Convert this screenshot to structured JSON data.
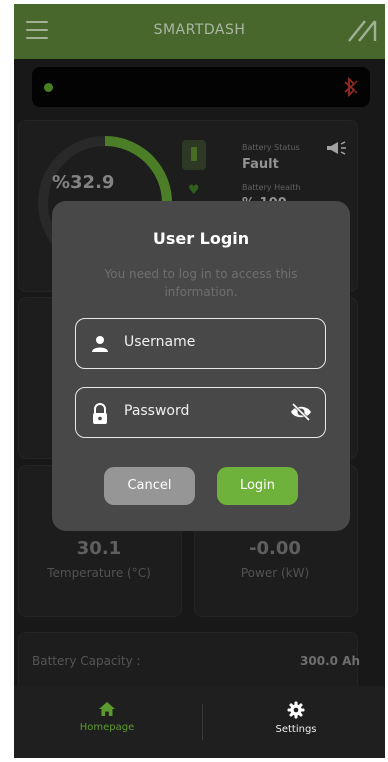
{
  "app": {
    "title": "SMARTDASH"
  },
  "dashboard": {
    "soc_value": "%32.9",
    "soc_fraction": 0.329,
    "battery_status_label": "Battery Status",
    "battery_status_value": "Fault",
    "battery_health_label": "Battery Health",
    "battery_health_value": "% 100",
    "temperature_value": "30.1",
    "temperature_label": "Temperature (°C)",
    "power_value": "-0.00",
    "power_label": "Power (kW)",
    "capacity_label": "Battery Capacity :",
    "capacity_value": "300.0 Ah"
  },
  "dialog": {
    "title": "User Login",
    "message": "You need to log in to access this information.",
    "username_placeholder": "Username",
    "password_placeholder": "Password",
    "cancel_label": "Cancel",
    "login_label": "Login"
  },
  "nav": {
    "home_label": "Homepage",
    "settings_label": "Settings"
  },
  "colors": {
    "accent": "#6fb23b",
    "appbar": "#5b843a",
    "status_bluetooth": "#c0392b"
  },
  "icons": [
    "menu-icon",
    "logo-icon",
    "status-dot",
    "bluetooth-off-icon",
    "battery-icon",
    "heart-icon",
    "horn-icon",
    "user-icon",
    "lock-icon",
    "eye-off-icon",
    "home-icon",
    "gear-icon"
  ]
}
